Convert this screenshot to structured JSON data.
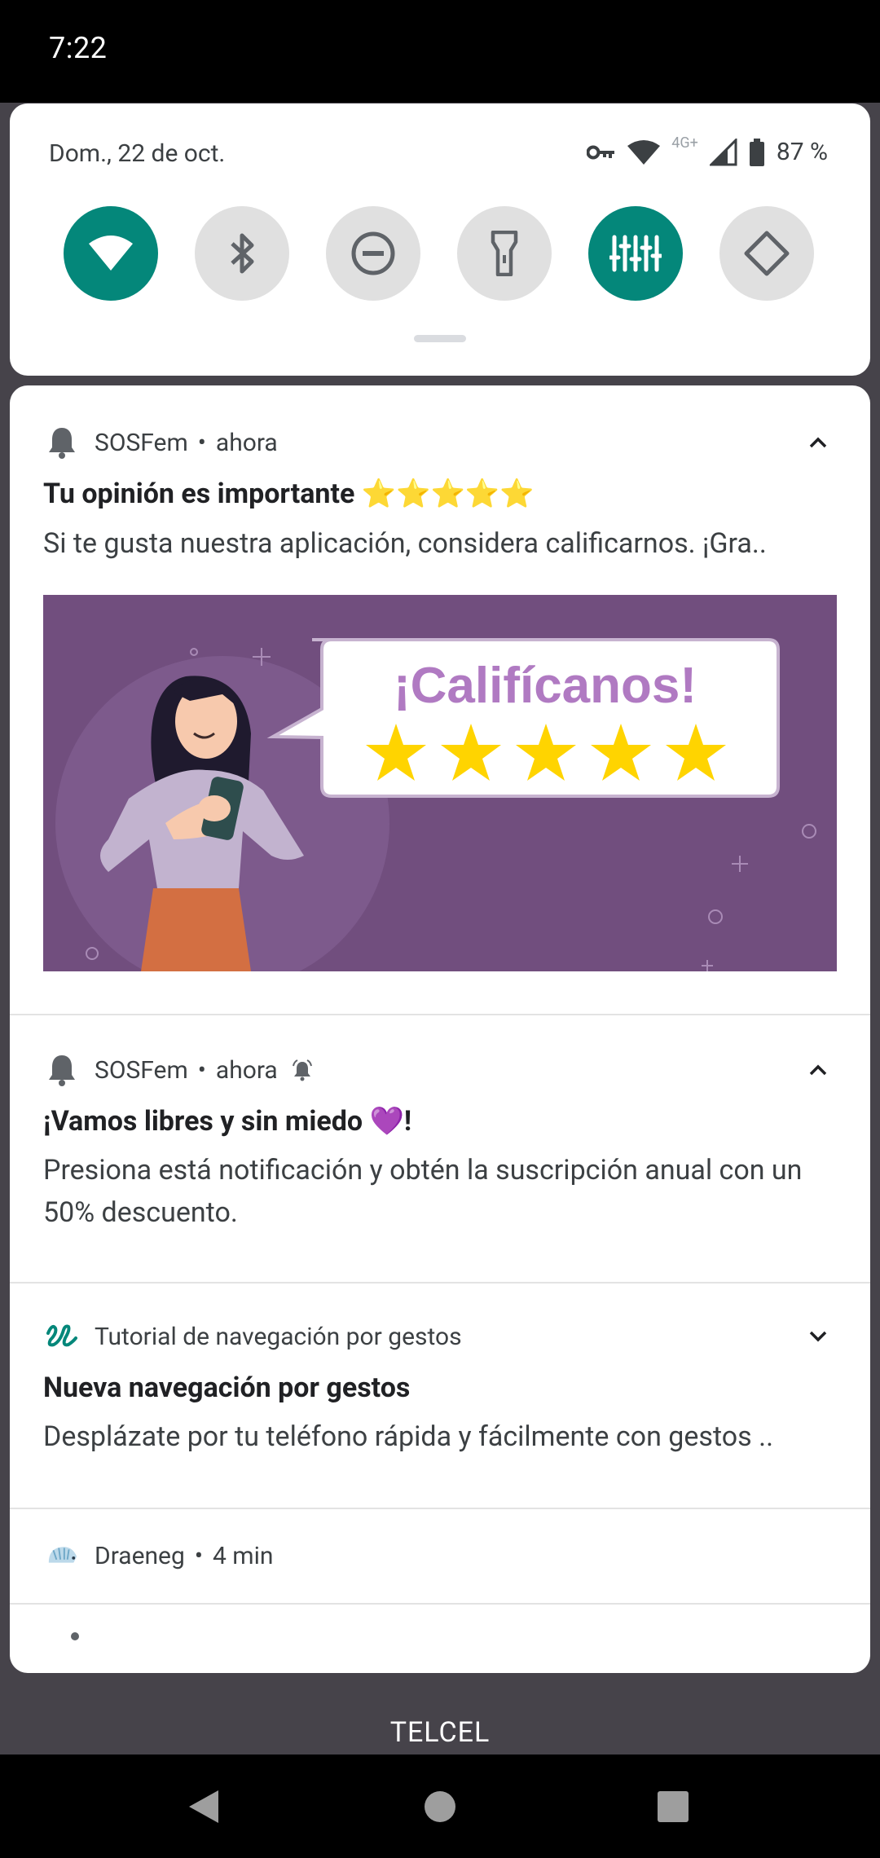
{
  "status_bar": {
    "time": "7:22"
  },
  "quick_settings": {
    "date": "Dom., 22 de oct.",
    "network_type": "4G+",
    "battery": "87 %",
    "tiles": [
      {
        "name": "wifi",
        "active": true
      },
      {
        "name": "bluetooth",
        "active": false
      },
      {
        "name": "do-not-disturb",
        "active": false
      },
      {
        "name": "flashlight",
        "active": false
      },
      {
        "name": "sound-settings",
        "active": true
      },
      {
        "name": "auto-rotate",
        "active": false
      }
    ]
  },
  "notifications": [
    {
      "app": "SOSFem",
      "time": "ahora",
      "title": "Tu opinión es importante ⭐⭐⭐⭐⭐",
      "text": "Si te gusta nuestra aplicación, considera calificarnos. ¡Gra..",
      "image": {
        "headline": "¡Califícanos!",
        "stars": 5
      }
    },
    {
      "app": "SOSFem",
      "time": "ahora",
      "title": "¡Vamos libres y sin miedo 💜!",
      "text": "Presiona está notificación y obtén la suscripción anual con un 50% descuento."
    },
    {
      "app": "Tutorial de navegación por gestos",
      "title": "Nueva navegación por gestos",
      "text": "Desplázate por tu teléfono rápida y fácilmente con gestos .."
    },
    {
      "app": "Draeneg",
      "time": "4 min"
    }
  ],
  "carrier": "TELCEL",
  "colors": {
    "accent": "#04877a",
    "banner": "#714e7e",
    "star": "#ffd400"
  }
}
